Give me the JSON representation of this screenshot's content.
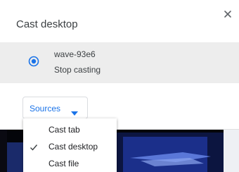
{
  "dialog": {
    "title": "Cast desktop"
  },
  "sink": {
    "name": "wave-93e6",
    "status": "Stop casting"
  },
  "sources_button": {
    "label": "Sources"
  },
  "sources_menu": {
    "items": [
      {
        "label": "Cast tab",
        "checked": false
      },
      {
        "label": "Cast desktop",
        "checked": true
      },
      {
        "label": "Cast file",
        "checked": false
      }
    ]
  },
  "colors": {
    "accent": "#1a73e8",
    "row_bg": "#ededed",
    "text": "#3c4043"
  },
  "icons": {
    "close": "close-icon",
    "sink": "cast-sink-radio-icon",
    "dropdown": "triangle-down-icon",
    "check": "checkmark-icon"
  }
}
